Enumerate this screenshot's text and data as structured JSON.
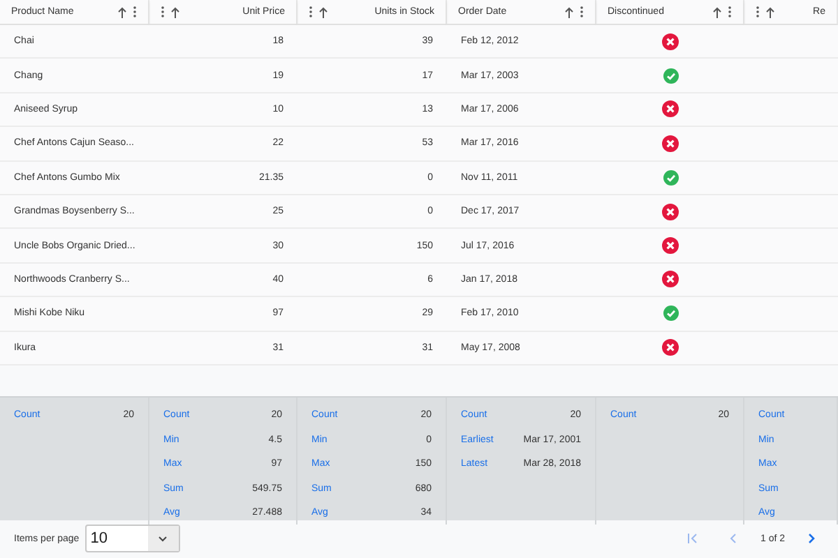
{
  "table": {
    "columns": [
      {
        "title": "Product Name",
        "kind": "text"
      },
      {
        "title": "Unit Price",
        "kind": "number"
      },
      {
        "title": "Units in Stock",
        "kind": "number"
      },
      {
        "title": "Order Date",
        "kind": "text"
      },
      {
        "title": "Discontinued",
        "kind": "text"
      },
      {
        "title": "Re",
        "kind": "number"
      }
    ],
    "rows": [
      {
        "name": "Chai",
        "price": "18",
        "stock": "39",
        "date": "Feb 12, 2012",
        "discontinued": false
      },
      {
        "name": "Chang",
        "price": "19",
        "stock": "17",
        "date": "Mar 17, 2003",
        "discontinued": true
      },
      {
        "name": "Aniseed Syrup",
        "price": "10",
        "stock": "13",
        "date": "Mar 17, 2006",
        "discontinued": false
      },
      {
        "name": "Chef Antons Cajun Seaso...",
        "price": "22",
        "stock": "53",
        "date": "Mar 17, 2016",
        "discontinued": false
      },
      {
        "name": "Chef Antons Gumbo Mix",
        "price": "21.35",
        "stock": "0",
        "date": "Nov 11, 2011",
        "discontinued": true
      },
      {
        "name": "Grandmas Boysenberry S...",
        "price": "25",
        "stock": "0",
        "date": "Dec 17, 2017",
        "discontinued": false
      },
      {
        "name": "Uncle Bobs Organic Dried...",
        "price": "30",
        "stock": "150",
        "date": "Jul 17, 2016",
        "discontinued": false
      },
      {
        "name": "Northwoods Cranberry S...",
        "price": "40",
        "stock": "6",
        "date": "Jan 17, 2018",
        "discontinued": false
      },
      {
        "name": "Mishi Kobe Niku",
        "price": "97",
        "stock": "29",
        "date": "Feb 17, 2010",
        "discontinued": true
      },
      {
        "name": "Ikura",
        "price": "31",
        "stock": "31",
        "date": "May 17, 2008",
        "discontinued": false
      }
    ],
    "summaries": [
      [
        {
          "label": "Count",
          "value": "20"
        }
      ],
      [
        {
          "label": "Count",
          "value": "20"
        },
        {
          "label": "Min",
          "value": "4.5"
        },
        {
          "label": "Max",
          "value": "97"
        },
        {
          "label": "Sum",
          "value": "549.75"
        },
        {
          "label": "Avg",
          "value": "27.488"
        }
      ],
      [
        {
          "label": "Count",
          "value": "20"
        },
        {
          "label": "Min",
          "value": "0"
        },
        {
          "label": "Max",
          "value": "150"
        },
        {
          "label": "Sum",
          "value": "680"
        },
        {
          "label": "Avg",
          "value": "34"
        }
      ],
      [
        {
          "label": "Count",
          "value": "20"
        },
        {
          "label": "Earliest",
          "value": "Mar 17, 2001"
        },
        {
          "label": "Latest",
          "value": "Mar 28, 2018"
        }
      ],
      [
        {
          "label": "Count",
          "value": "20"
        }
      ],
      [
        {
          "label": "Count"
        },
        {
          "label": "Min"
        },
        {
          "label": "Max"
        },
        {
          "label": "Sum"
        },
        {
          "label": "Avg"
        }
      ]
    ]
  },
  "paginator": {
    "items_per_page_label": "Items per page",
    "items_per_page": "10",
    "page_info": "1 of 2"
  }
}
